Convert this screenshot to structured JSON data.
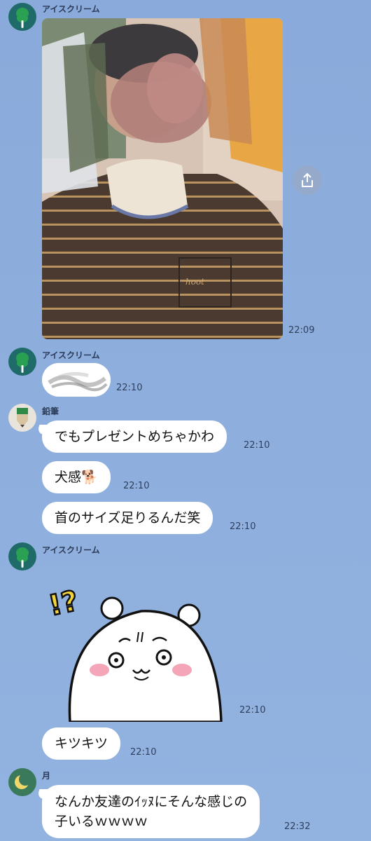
{
  "messages": {
    "m1": {
      "sender": "アイスクリーム",
      "time": "22:09"
    },
    "m2": {
      "sender": "アイスクリーム",
      "time": "22:10"
    },
    "m3": {
      "sender": "鉛筆",
      "text": "でもプレゼントめちゃかわ",
      "time": "22:10"
    },
    "m4": {
      "text": "犬感🐕",
      "time": "22:10"
    },
    "m5": {
      "text": "首のサイズ足りるんだ笑",
      "time": "22:10"
    },
    "m6": {
      "sender": "アイスクリーム",
      "time": "22:10"
    },
    "m7": {
      "text": "キツキツ",
      "time": "22:10"
    },
    "m8": {
      "sender": "月",
      "text_line1": "なんか友達のｲｯﾇにそんな感じの",
      "text_line2": "子いるｗｗｗｗ",
      "time": "22:32"
    }
  },
  "sticker_text": "!?",
  "photo_text": "hoot",
  "icons": {
    "avatar_ice": "ice-cream-avatar-icon",
    "avatar_pencil": "pencil-avatar-icon",
    "avatar_moon": "moon-avatar-icon",
    "share": "share-icon"
  },
  "colors": {
    "background": "#8aabdc",
    "bubble": "#ffffff",
    "ice_avatar_bg": "#1f6b6a",
    "ice_avatar_fg": "#2aa152",
    "moon_avatar_bg": "#3a7a5a",
    "moon": "#f1d66a"
  }
}
